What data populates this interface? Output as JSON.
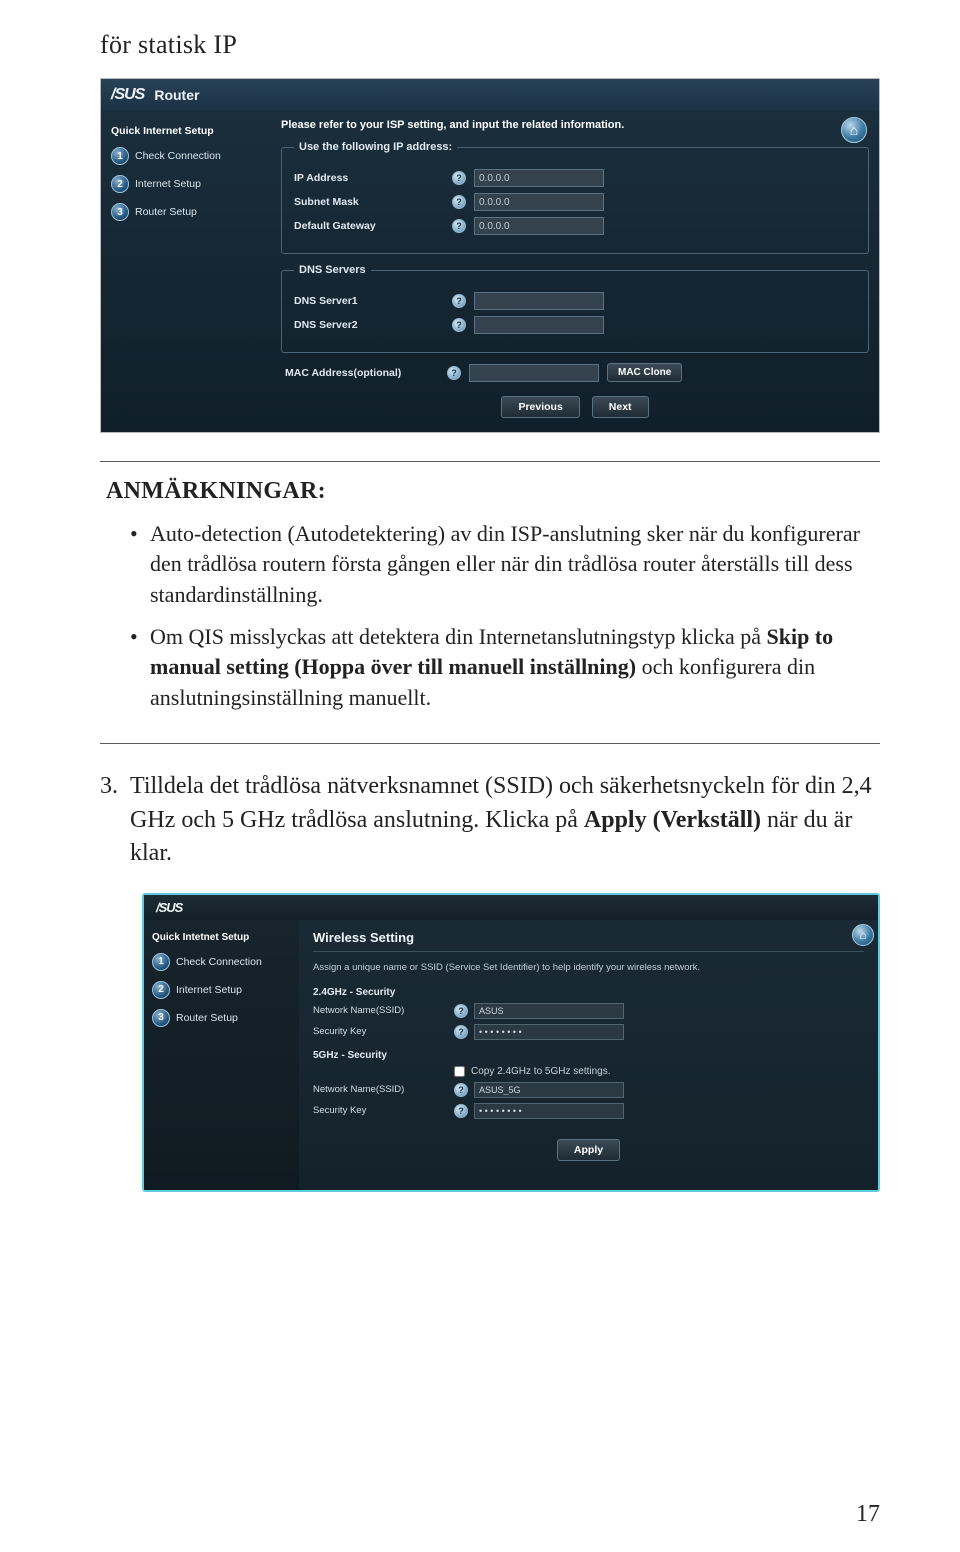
{
  "doc": {
    "title": "för statisk IP",
    "page_number": "17"
  },
  "shot1": {
    "brand": "/SUS",
    "product": "Router",
    "quick_setup": "Quick Internet Setup",
    "steps": [
      "Check Connection",
      "Internet Setup",
      "Router Setup"
    ],
    "instruction": "Please refer to your ISP setting, and input the related information.",
    "fieldset_ip": {
      "legend": "Use the following IP address:",
      "rows": [
        {
          "label": "IP Address",
          "value": "0.0.0.0"
        },
        {
          "label": "Subnet Mask",
          "value": "0.0.0.0"
        },
        {
          "label": "Default Gateway",
          "value": "0.0.0.0"
        }
      ]
    },
    "fieldset_dns": {
      "legend": "DNS Servers",
      "rows": [
        {
          "label": "DNS Server1",
          "value": ""
        },
        {
          "label": "DNS Server2",
          "value": ""
        }
      ]
    },
    "mac_label": "MAC Address(optional)",
    "mac_value": "",
    "mac_clone_btn": "MAC Clone",
    "prev_btn": "Previous",
    "next_btn": "Next",
    "home_icon": "⌂"
  },
  "notes": {
    "heading": "ANMÄRKNINGAR:",
    "items": [
      {
        "text": "Auto-detection (Autodetektering) av din ISP-anslutning sker när du konfigurerar den trådlösa routern första gången eller när din trådlösa router återställs till dess standardinställning."
      },
      {
        "before": "Om QIS misslyckas att detektera din Internetanslutningstyp klicka på ",
        "bold": "Skip to manual setting (Hoppa över till manuell inställning)",
        "after": " och konfigurera din anslutningsinställning manuellt."
      }
    ]
  },
  "para3": {
    "num": "3.",
    "before": "Tilldela det trådlösa nätverksnamnet (SSID) och säkerhetsnyckeln för din 2,4 GHz och 5 GHz trådlösa anslutning. Klicka på  ",
    "bold": "Apply (Verkställ)",
    "after": " när du är klar."
  },
  "shot2": {
    "brand": "/SUS",
    "quick_setup": "Quick Intetnet Setup",
    "steps": [
      "Check Connection",
      "Internet Setup",
      "Router Setup"
    ],
    "panel_title": "Wireless Setting",
    "instruction": "Assign a unique name or SSID (Service Set Identifier) to help identify your wireless network.",
    "home_icon": "⌂",
    "section24": "2.4GHz - Security",
    "net_label": "Network Name(SSID)",
    "net24_value": "ASUS",
    "sec_label": "Security Key",
    "sec24_value": "• • • • • • • •",
    "section5": "5GHz - Security",
    "copy_label": "Copy 2.4GHz to 5GHz settings.",
    "net5_value": "ASUS_5G",
    "sec5_value": "• • • • • • • •",
    "apply_btn": "Apply"
  }
}
